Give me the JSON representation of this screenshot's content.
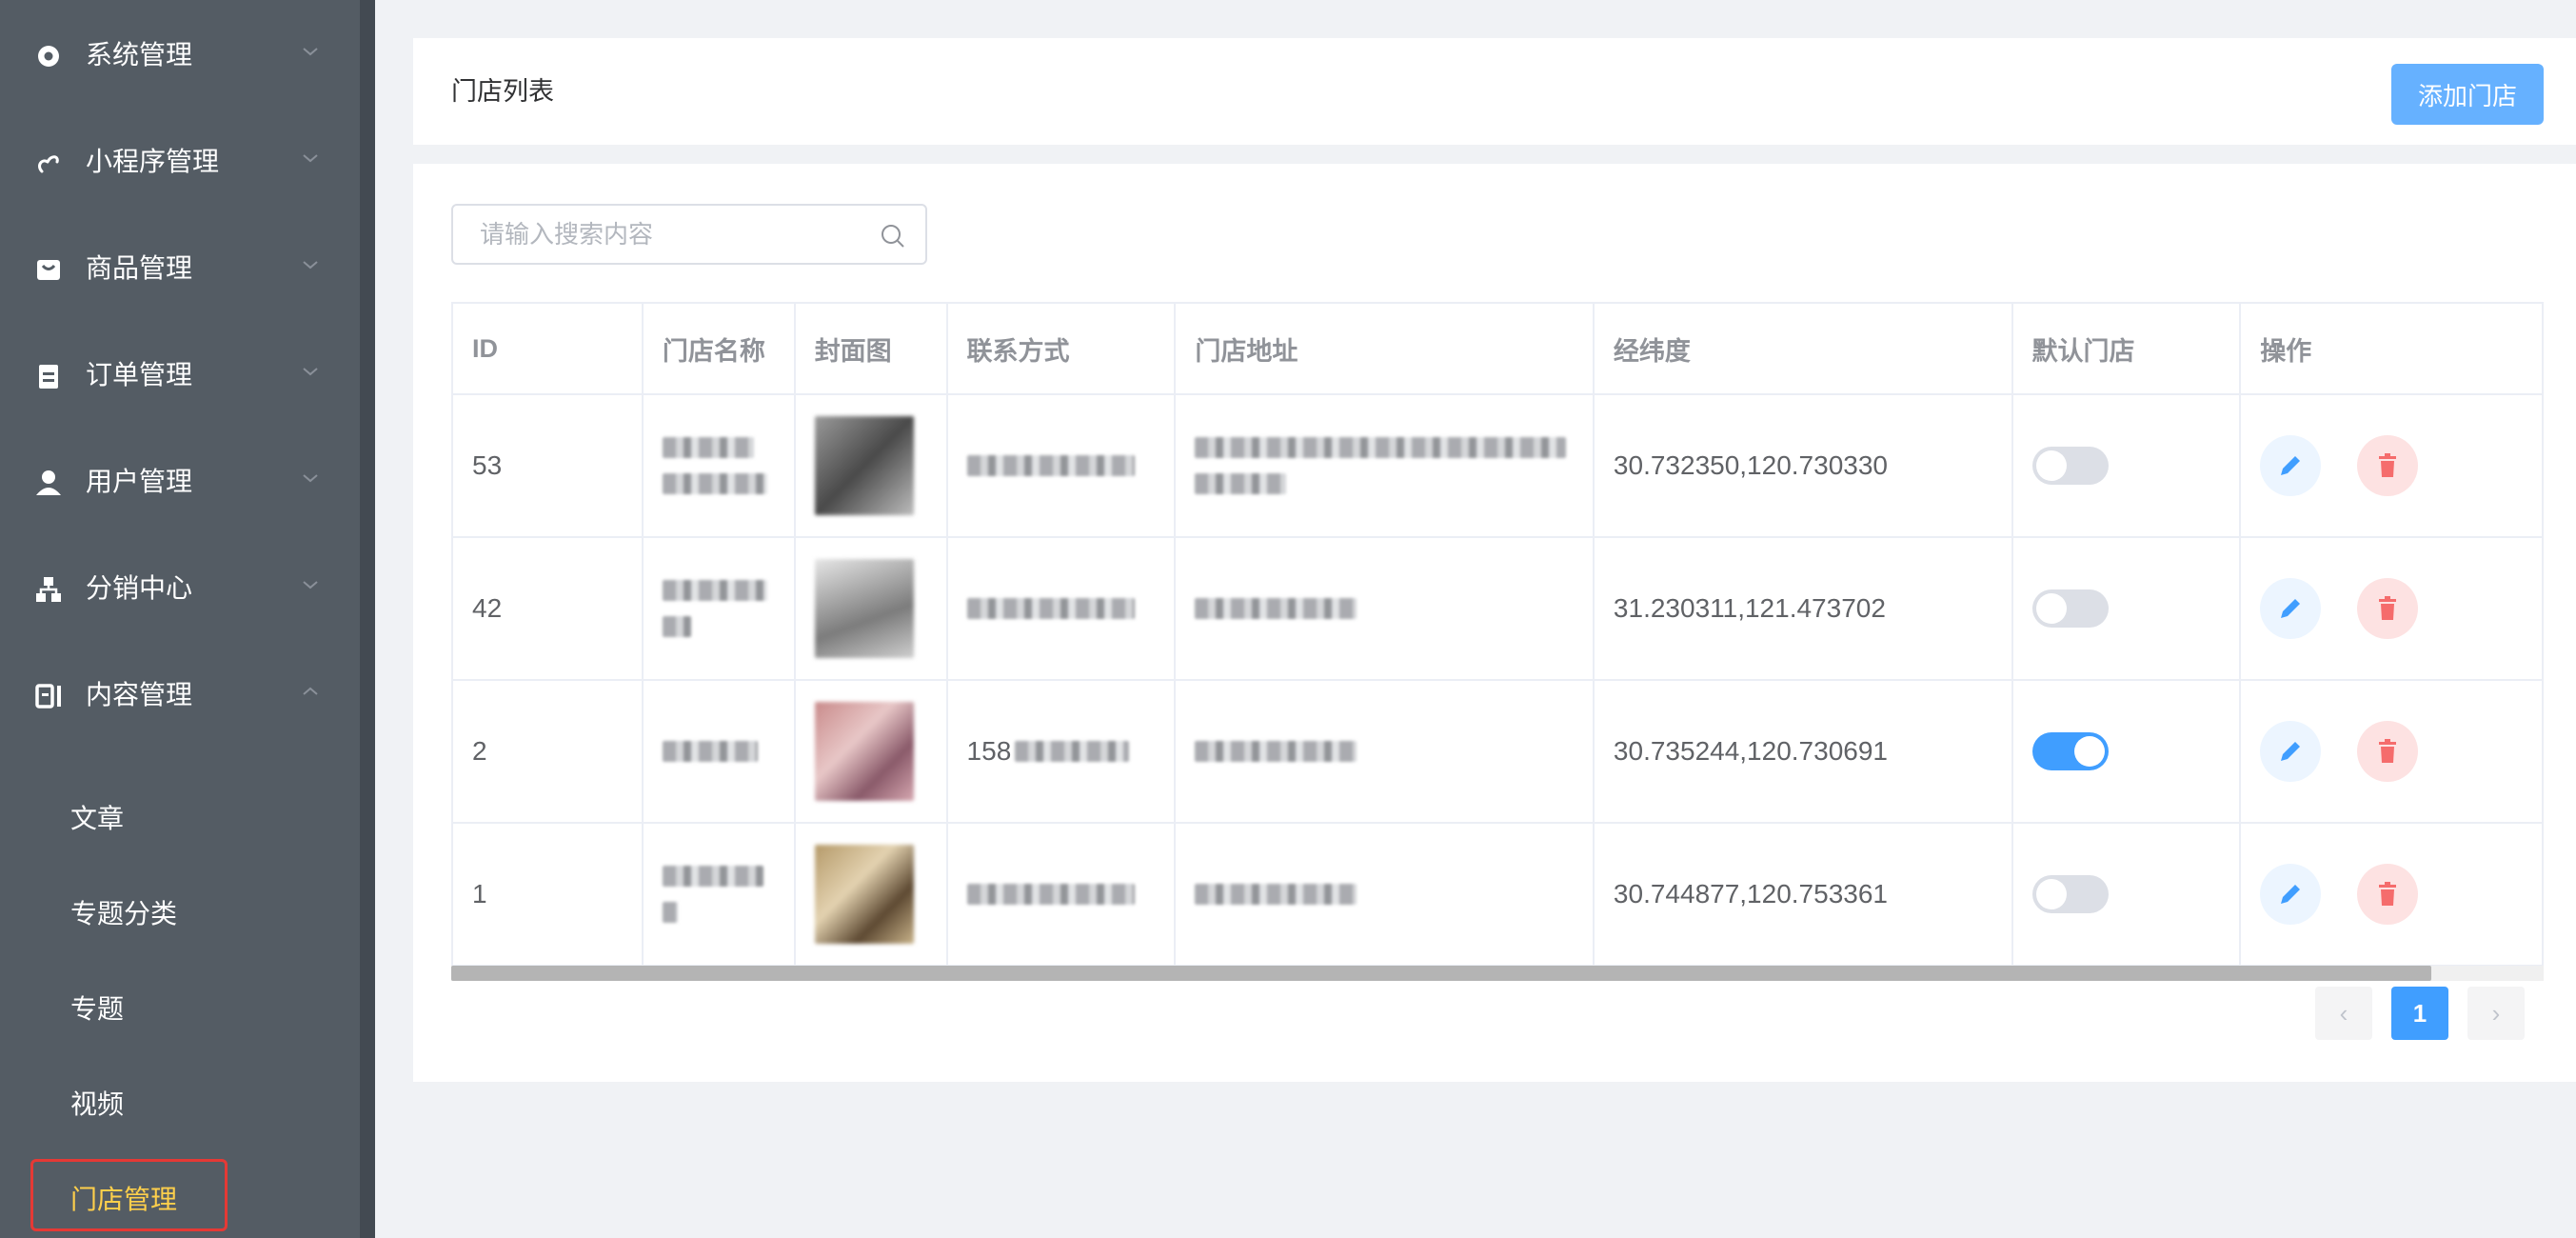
{
  "sidebar": {
    "menus": [
      {
        "label": "系统管理",
        "icon": "gear-icon",
        "expanded": false
      },
      {
        "label": "小程序管理",
        "icon": "link-icon",
        "expanded": false
      },
      {
        "label": "商品管理",
        "icon": "bag-icon",
        "expanded": false
      },
      {
        "label": "订单管理",
        "icon": "clipboard-icon",
        "expanded": false
      },
      {
        "label": "用户管理",
        "icon": "user-icon",
        "expanded": false
      },
      {
        "label": "分销中心",
        "icon": "network-icon",
        "expanded": false
      },
      {
        "label": "内容管理",
        "icon": "content-icon",
        "expanded": true
      }
    ],
    "sub_items": [
      {
        "label": "文章"
      },
      {
        "label": "专题分类"
      },
      {
        "label": "专题"
      },
      {
        "label": "视频"
      },
      {
        "label": "门店管理",
        "active": true
      }
    ],
    "active_color": "#ffd04b",
    "bg_color": "#545c64"
  },
  "header": {
    "title": "门店列表",
    "add_button": "添加门店"
  },
  "search": {
    "placeholder": "请输入搜索内容"
  },
  "table": {
    "columns": [
      "ID",
      "门店名称",
      "封面图",
      "联系方式",
      "门店地址",
      "经纬度",
      "默认门店",
      "操作"
    ],
    "rows": [
      {
        "id": "53",
        "coords": "30.732350,120.730330",
        "default": false
      },
      {
        "id": "42",
        "coords": "31.230311,121.473702",
        "default": false
      },
      {
        "id": "2",
        "phone_visible": "158",
        "coords": "30.735244,120.730691",
        "default": true
      },
      {
        "id": "1",
        "coords": "30.744877,120.753361",
        "default": false
      }
    ]
  },
  "pagination": {
    "prev": "‹",
    "current": "1",
    "next": "›"
  },
  "colors": {
    "primary": "#409eff",
    "add_button": "#66b1ff",
    "danger_bg": "#fde2e2",
    "danger_icon": "#f56c6c"
  }
}
